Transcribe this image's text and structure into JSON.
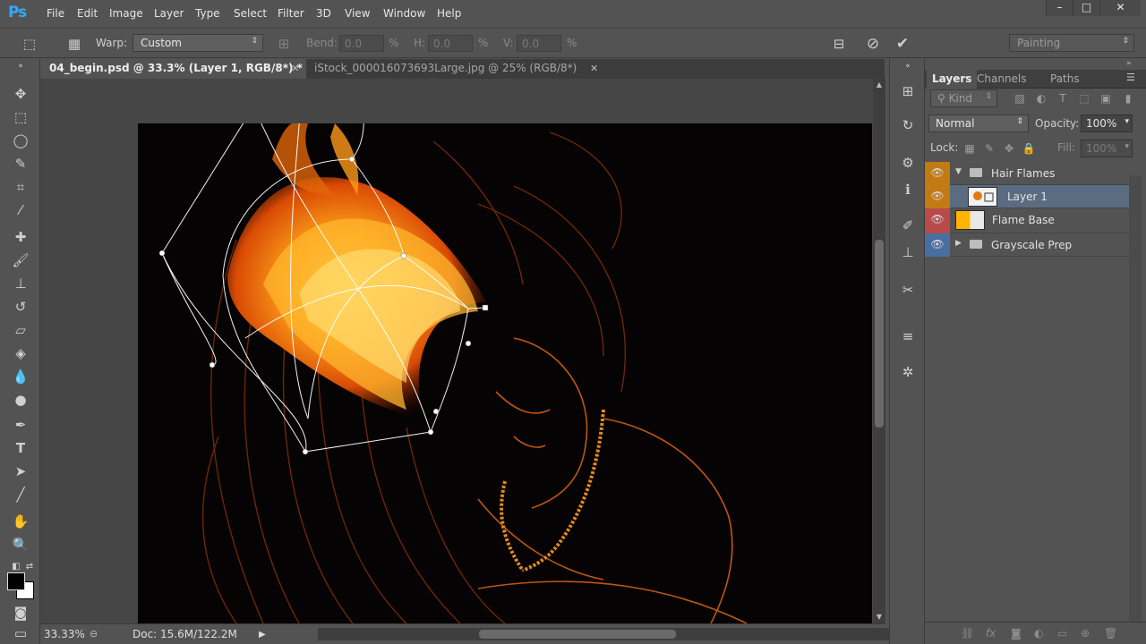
{
  "app": {
    "logo": "Ps"
  },
  "menu": [
    "File",
    "Edit",
    "Image",
    "Layer",
    "Type",
    "Select",
    "Filter",
    "3D",
    "View",
    "Window",
    "Help"
  ],
  "window_controls": [
    "–",
    "□",
    "✕"
  ],
  "options_bar": {
    "warp_label": "Warp:",
    "warp_value": "Custom",
    "bend_label": "Bend:",
    "bend_value": "0.0",
    "h_label": "H:",
    "h_value": "0.0",
    "v_label": "V:",
    "v_value": "0.0",
    "percent": "%",
    "workspace": "Painting"
  },
  "tabs": [
    {
      "label": "04_begin.psd @ 33.3% (Layer 1, RGB/8*) *",
      "active": true
    },
    {
      "label": "iStock_000016073693Large.jpg @ 25% (RGB/8*)",
      "active": false
    }
  ],
  "status": {
    "zoom": "33.33%",
    "doc": "Doc: 15.6M/122.2M"
  },
  "layers_panel": {
    "tabs": [
      "Layers",
      "Channels",
      "Paths"
    ],
    "filter_kind": "Kind",
    "blend_mode": "Normal",
    "opacity_label": "Opacity:",
    "opacity_value": "100%",
    "lock_label": "Lock:",
    "fill_label": "Fill:",
    "fill_value": "100%",
    "layers": [
      {
        "name": "Hair Flames",
        "type": "group",
        "expanded": true,
        "color": "#c27a12"
      },
      {
        "name": "Layer 1",
        "type": "layer",
        "selected": true,
        "color": "#c27a12"
      },
      {
        "name": "Flame Base",
        "type": "layer",
        "color": "#b84a4a"
      },
      {
        "name": "Grayscale Prep",
        "type": "group",
        "expanded": false,
        "color": "#4a6ea0"
      }
    ]
  },
  "colors": {
    "accent_logo": "#31a8ff",
    "layer_orange": "#c27a12",
    "layer_red": "#b84a4a",
    "layer_blue": "#4a6ea0",
    "selected_row": "#5b6c82"
  }
}
